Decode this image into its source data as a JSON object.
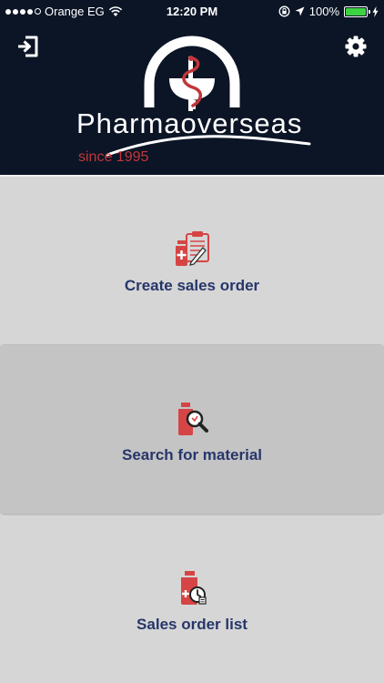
{
  "status_bar": {
    "carrier": "Orange EG",
    "time": "12:20 PM",
    "battery": "100%"
  },
  "header": {
    "brand": "Pharmaoverseas",
    "since": "since 1995",
    "logout_icon": "logout-icon",
    "settings_icon": "gear-icon"
  },
  "menu": [
    {
      "label": "Create sales order",
      "icon": "clipboard-medicine-icon"
    },
    {
      "label": "Search for material",
      "icon": "search-medicine-icon"
    },
    {
      "label": "Sales order list",
      "icon": "order-list-icon"
    }
  ],
  "colors": {
    "header_bg": "#0b1526",
    "accent_red": "#d64545",
    "label_blue": "#27366a",
    "tile_bg": "#d6d6d6",
    "tile_active_bg": "#c4c4c4"
  }
}
